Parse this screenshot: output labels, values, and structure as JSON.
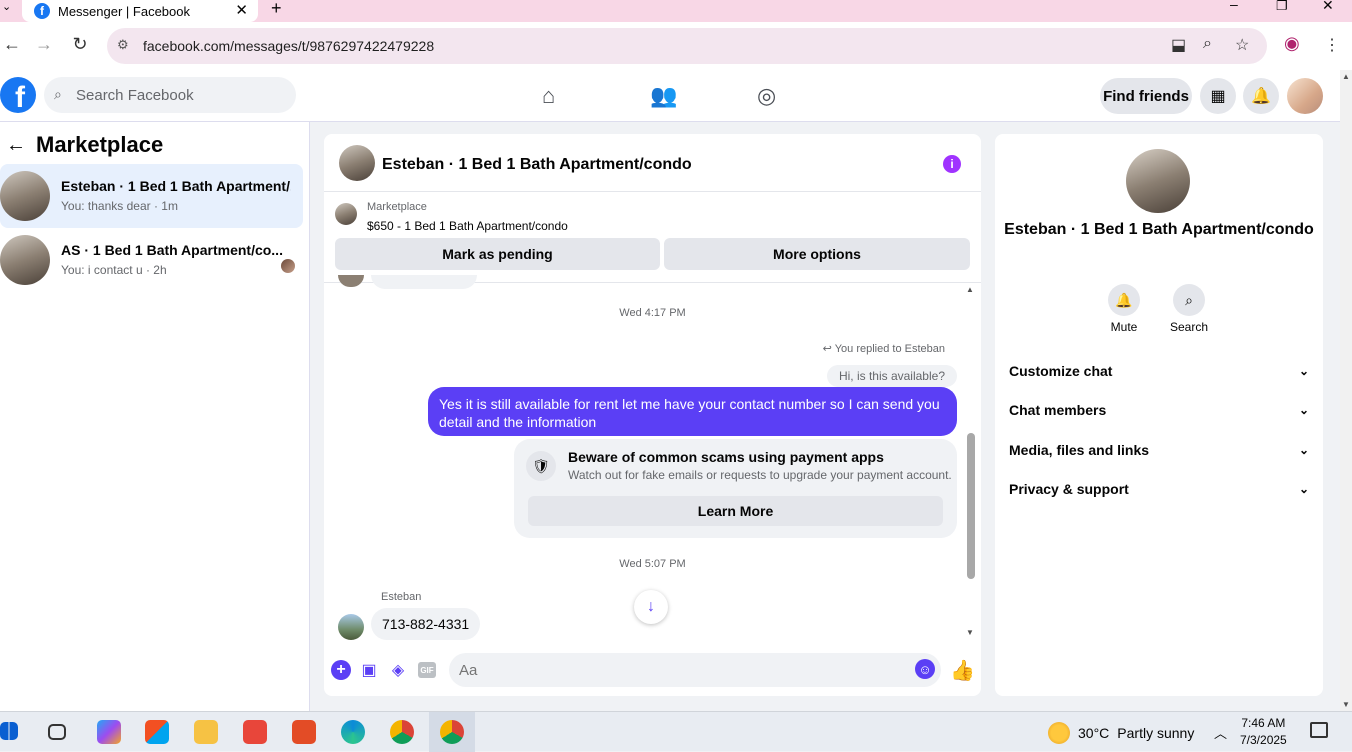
{
  "browser": {
    "tab_title": "Messenger | Facebook",
    "tab_close": "✕",
    "new_tab": "+",
    "url": "facebook.com/messages/t/9876297422479228",
    "window_controls": [
      "–",
      "❐",
      "✕"
    ]
  },
  "fb_header": {
    "search_placeholder": "Search Facebook",
    "find_friends": "Find friends"
  },
  "sidebar": {
    "title": "Marketplace",
    "conversations": [
      {
        "title": "Esteban · 1 Bed 1 Bath Apartment/...",
        "preview": "You: thanks dear · 1m"
      },
      {
        "title": "AS · 1 Bed 1 Bath Apartment/co...",
        "preview": "You: i contact u · 2h"
      }
    ]
  },
  "chat": {
    "header_name": "Esteban · 1 Bed 1 Bath Apartment/condo",
    "info_icon": "i",
    "banner_label": "Marketplace",
    "banner_listing": "$650 - 1 Bed 1 Bath Apartment/condo",
    "btn_pending": "Mark as pending",
    "btn_more": "More options",
    "ts1": "Wed 4:17 PM",
    "reply_note": "You replied to Esteban",
    "quoted": "Hi, is this available?",
    "my_message": "Yes it is still available for rent let me have your contact number so I can send you detail and the information",
    "scam_title": "Beware of common scams using payment apps",
    "scam_desc": "Watch out for fake emails or requests to upgrade your payment account.",
    "scam_btn": "Learn More",
    "ts2": "Wed 5:07 PM",
    "sender": "Esteban",
    "phone_msg": "713-882-4331",
    "input_placeholder": "Aa",
    "gif_label": "GIF"
  },
  "rightpane": {
    "name": "Esteban · 1 Bed 1 Bath Apartment/condo",
    "mute": "Mute",
    "search": "Search",
    "sections": [
      "Customize chat",
      "Chat members",
      "Media, files and links",
      "Privacy & support"
    ]
  },
  "taskbar": {
    "temp": "30°C",
    "weather": "Partly sunny",
    "time": "7:46 AM",
    "date": "7/3/2025"
  },
  "colors": {
    "accent": "#5b3ff5",
    "fb_blue": "#1877f2",
    "tab_bar": "#f8d7e6"
  }
}
